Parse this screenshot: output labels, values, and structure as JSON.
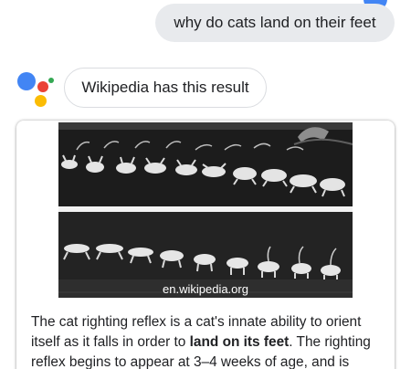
{
  "colors": {
    "google_blue": "#4285f4",
    "google_red": "#ea4335",
    "google_yellow": "#fbbc04",
    "google_green": "#34a853",
    "user_bubble_bg": "#e8eaed",
    "text": "#202124"
  },
  "conversation": {
    "user_query": "why do cats land on their feet",
    "assistant_reply": "Wikipedia has this result"
  },
  "result_card": {
    "image_caption": "en.wikipedia.org",
    "snippet_before": "The cat righting reflex is a cat's innate ability to orient itself as it falls in order to ",
    "snippet_bold": "land on its feet",
    "snippet_after": ". The righting reflex begins to appear at 3–4 weeks of age, and is"
  },
  "icons": {
    "assistant": "google-assistant-dots-icon",
    "user_avatar": "user-avatar"
  }
}
